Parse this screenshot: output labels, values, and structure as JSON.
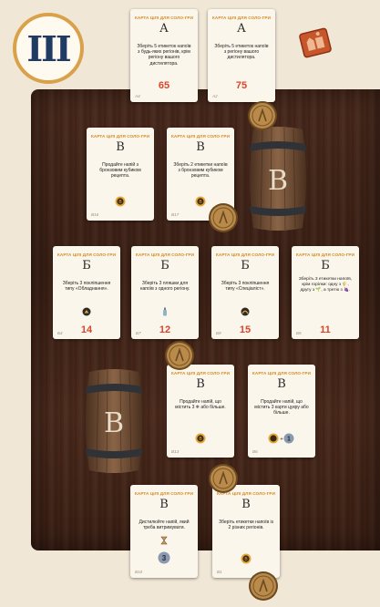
{
  "badge": {
    "numeral": "III"
  },
  "card_header": "КАРТА ЦІЛІ ДЛЯ СОЛО-ГРИ",
  "barrel_letter": "B",
  "cards": [
    {
      "letter": "A",
      "text": "Зберіть 5 етикеток напоїв з будь-яких регіонів, крім регіону вашого дистилятора.",
      "points": "65",
      "code": "A4",
      "icon": ""
    },
    {
      "letter": "A",
      "text": "Зберіть 5 етикеток напоїв з регіону вашого дистилятора.",
      "points": "75",
      "code": "A2",
      "icon": ""
    },
    {
      "letter": "B",
      "text": "Продайте напій з бронзовим кубиком рецепта.",
      "points": "",
      "code": "B16",
      "icon": "bronze-medal"
    },
    {
      "letter": "B",
      "text": "Зберіть 2 етикетки напоїв з бронзовим кубиком рецепта.",
      "points": "",
      "code": "B17",
      "icon": "bronze-medal"
    },
    {
      "letter": "Б",
      "text": "Зберіть 3 покліпшення типу «Обладнання».",
      "points": "14",
      "code": "Б4",
      "icon": "equipment"
    },
    {
      "letter": "Б",
      "text": "Зберіть 3 пляшки для напоїв з одного регіону.",
      "points": "12",
      "code": "Б7",
      "icon": "bottle"
    },
    {
      "letter": "Б",
      "text": "Зберіть 3 покліпшення типу «Спеціаліст».",
      "points": "15",
      "code": "Б9",
      "icon": "specialist"
    },
    {
      "letter": "Б",
      "text": "Зберіть 3 етикетки напоїв, крім горілки: одну з 🌾, другу з 🌱, а третю з 🍇.",
      "points": "11",
      "code": "Б5",
      "icon": ""
    },
    {
      "letter": "B",
      "text": "Продайте напій, що містить 3 ❄ або більше.",
      "points": "",
      "code": "B13",
      "icon": "bronze-medal"
    },
    {
      "letter": "B",
      "text": "Продайте напій, що містить 3 карти цукру або більше.",
      "points": "",
      "code": "B6",
      "icon": "bronze-medal-1"
    },
    {
      "letter": "B",
      "text": "Дистилюйте напій, який треба витримувати.",
      "points": "",
      "code": "B10",
      "icon": "hourglass-3"
    },
    {
      "letter": "B",
      "text": "Зберіть етикетки напоїв із 2 різних регіонів.",
      "points": "",
      "code": "B1",
      "icon": "bronze-medal"
    }
  ],
  "extras": {
    "cube_count_1": "1",
    "cube_count_3": "3"
  },
  "colors": {
    "wood": "#3f2317",
    "card": "#fbf6ec",
    "header": "#d4891e",
    "points": "#d9452b",
    "badge_ring": "#d9a24a",
    "numeral": "#1f3a63",
    "coin": "#b98a4a"
  }
}
